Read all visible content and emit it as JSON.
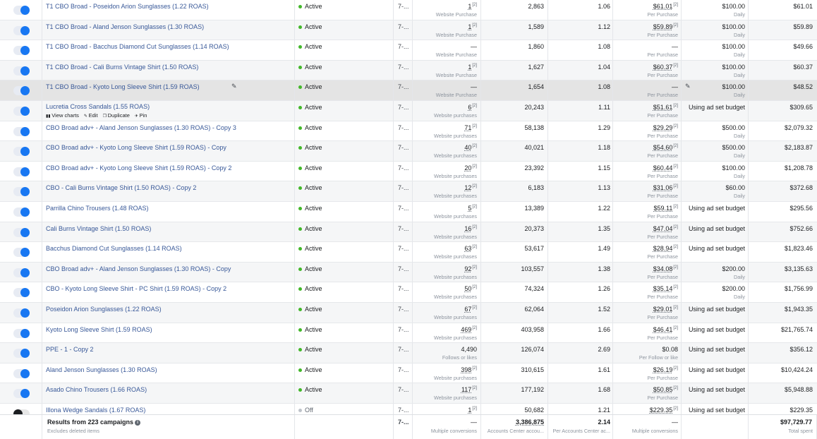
{
  "rows": [
    {
      "on": true,
      "name": "T1 CBO Broad - Poseidon Arion Sunglasses (1.22 ROAS)",
      "status": "Active",
      "attribution": "7-...",
      "results": "1",
      "results_sub": "Website Purchase",
      "reach": "2,863",
      "frequency": "1.06",
      "cost": "$61.01",
      "cost_sub": "Per Purchase",
      "budget": "$100.00",
      "budget_sub": "Daily",
      "spent": "$61.01"
    },
    {
      "on": true,
      "name": "T1 CBO Broad - Aland Jenson Sunglasses (1.30 ROAS)",
      "status": "Active",
      "attribution": "7-...",
      "results": "1",
      "results_sub": "Website Purchase",
      "reach": "1,589",
      "frequency": "1.12",
      "cost": "$59.89",
      "cost_sub": "Per Purchase",
      "budget": "$100.00",
      "budget_sub": "Daily",
      "spent": "$59.89"
    },
    {
      "on": true,
      "name": "T1 CBO Broad - Bacchus Diamond Cut Sunglasses (1.14 ROAS)",
      "status": "Active",
      "attribution": "7-...",
      "results": "—",
      "results_sub": "Website Purchase",
      "reach": "1,860",
      "frequency": "1.08",
      "cost": "—",
      "cost_sub": "Per Purchase",
      "budget": "$100.00",
      "budget_sub": "Daily",
      "spent": "$49.66"
    },
    {
      "on": true,
      "name": "T1 CBO Broad - Cali Burns Vintage Shirt (1.50 ROAS)",
      "status": "Active",
      "attribution": "7-...",
      "results": "1",
      "results_sub": "Website Purchase",
      "reach": "1,627",
      "frequency": "1.04",
      "cost": "$60.37",
      "cost_sub": "Per Purchase",
      "budget": "$100.00",
      "budget_sub": "Daily",
      "spent": "$60.37"
    },
    {
      "on": true,
      "name": "T1 CBO Broad - Kyoto Long Sleeve Shirt (1.59 ROAS)",
      "status": "Active",
      "attribution": "7-...",
      "results": "—",
      "results_sub": "Website Purchase",
      "reach": "1,654",
      "frequency": "1.08",
      "cost": "—",
      "cost_sub": "Per Purchase",
      "budget": "$100.00",
      "budget_sub": "Daily",
      "spent": "$48.52",
      "highlight": true
    },
    {
      "on": true,
      "name": "Lucretia Cross Sandals (1.55 ROAS)",
      "status": "Active",
      "attribution": "7-...",
      "results": "6",
      "results_sub": "Website purchases",
      "reach": "20,243",
      "frequency": "1.11",
      "cost": "$51.61",
      "cost_sub": "Per Purchase",
      "budget": "Using ad set budget",
      "budget_sub": "",
      "spent": "$309.65",
      "actions": {
        "view_charts": "View charts",
        "edit": "Edit",
        "duplicate": "Duplicate",
        "pin": "Pin"
      }
    },
    {
      "on": true,
      "name": "CBO Broad adv+ - Aland Jenson Sunglasses (1.30 ROAS) - Copy 3",
      "status": "Active",
      "attribution": "7-...",
      "results": "71",
      "results_sub": "Website purchases",
      "reach": "58,138",
      "frequency": "1.29",
      "cost": "$29.29",
      "cost_sub": "Per Purchase",
      "budget": "$500.00",
      "budget_sub": "Daily",
      "spent": "$2,079.32"
    },
    {
      "on": true,
      "name": "CBO Broad adv+ - Kyoto Long Sleeve Shirt (1.59 ROAS) - Copy",
      "status": "Active",
      "attribution": "7-...",
      "results": "40",
      "results_sub": "Website purchases",
      "reach": "40,021",
      "frequency": "1.18",
      "cost": "$54.60",
      "cost_sub": "Per Purchase",
      "budget": "$500.00",
      "budget_sub": "Daily",
      "spent": "$2,183.87"
    },
    {
      "on": true,
      "name": "CBO Broad adv+ - Kyoto Long Sleeve Shirt (1.59 ROAS) - Copy 2",
      "status": "Active",
      "attribution": "7-...",
      "results": "20",
      "results_sub": "Website purchases",
      "reach": "23,392",
      "frequency": "1.15",
      "cost": "$60.44",
      "cost_sub": "Per Purchase",
      "budget": "$100.00",
      "budget_sub": "Daily",
      "spent": "$1,208.78"
    },
    {
      "on": true,
      "name": "CBO - Cali Burns Vintage Shirt (1.50 ROAS) - Copy 2",
      "status": "Active",
      "attribution": "7-...",
      "results": "12",
      "results_sub": "Website purchases",
      "reach": "6,183",
      "frequency": "1.13",
      "cost": "$31.06",
      "cost_sub": "Per Purchase",
      "budget": "$60.00",
      "budget_sub": "Daily",
      "spent": "$372.68"
    },
    {
      "on": true,
      "name": "Parrilla Chino Trousers (1.48 ROAS)",
      "status": "Active",
      "attribution": "7-...",
      "results": "5",
      "results_sub": "Website purchases",
      "reach": "13,389",
      "frequency": "1.22",
      "cost": "$59.11",
      "cost_sub": "Per Purchase",
      "budget": "Using ad set budget",
      "budget_sub": "",
      "spent": "$295.56"
    },
    {
      "on": true,
      "name": "Cali Burns Vintage Shirt (1.50 ROAS)",
      "status": "Active",
      "attribution": "7-...",
      "results": "16",
      "results_sub": "Website purchases",
      "reach": "20,373",
      "frequency": "1.35",
      "cost": "$47.04",
      "cost_sub": "Per Purchase",
      "budget": "Using ad set budget",
      "budget_sub": "",
      "spent": "$752.66"
    },
    {
      "on": true,
      "name": "Bacchus Diamond Cut Sunglasses (1.14 ROAS)",
      "status": "Active",
      "attribution": "7-...",
      "results": "63",
      "results_sub": "Website purchases",
      "reach": "53,617",
      "frequency": "1.49",
      "cost": "$28.94",
      "cost_sub": "Per Purchase",
      "budget": "Using ad set budget",
      "budget_sub": "",
      "spent": "$1,823.46"
    },
    {
      "on": true,
      "name": "CBO Broad adv+ - Aland Jenson Sunglasses (1.30 ROAS) - Copy",
      "status": "Active",
      "attribution": "7-...",
      "results": "92",
      "results_sub": "Website purchases",
      "reach": "103,557",
      "frequency": "1.38",
      "cost": "$34.08",
      "cost_sub": "Per Purchase",
      "budget": "$200.00",
      "budget_sub": "Daily",
      "spent": "$3,135.63"
    },
    {
      "on": true,
      "name": "CBO - Kyoto Long Sleeve Shirt - PC Shirt (1.59 ROAS) - Copy 2",
      "status": "Active",
      "attribution": "7-...",
      "results": "50",
      "results_sub": "Website purchases",
      "reach": "74,324",
      "frequency": "1.26",
      "cost": "$35.14",
      "cost_sub": "Per Purchase",
      "budget": "$200.00",
      "budget_sub": "Daily",
      "spent": "$1,756.99"
    },
    {
      "on": true,
      "name": "Poseidon Arion Sunglasses (1.22 ROAS)",
      "status": "Active",
      "attribution": "7-...",
      "results": "67",
      "results_sub": "Website purchases",
      "reach": "62,064",
      "frequency": "1.52",
      "cost": "$29.01",
      "cost_sub": "Per Purchase",
      "budget": "Using ad set budget",
      "budget_sub": "",
      "spent": "$1,943.35"
    },
    {
      "on": true,
      "name": "Kyoto Long Sleeve Shirt (1.59 ROAS)",
      "status": "Active",
      "attribution": "7-...",
      "results": "469",
      "results_sub": "Website purchases",
      "reach": "403,958",
      "frequency": "1.66",
      "cost": "$46.41",
      "cost_sub": "Per Purchase",
      "budget": "Using ad set budget",
      "budget_sub": "",
      "spent": "$21,765.74"
    },
    {
      "on": true,
      "name": "PPE - 1 - Copy 2",
      "status": "Active",
      "attribution": "7-...",
      "results": "4,490",
      "results_sub": "Follows or likes",
      "reach": "126,074",
      "frequency": "2.69",
      "cost": "$0.08",
      "cost_sub": "Per Follow or like",
      "budget": "Using ad set budget",
      "budget_sub": "",
      "spent": "$356.12",
      "plain_results": true
    },
    {
      "on": true,
      "name": "Aland Jenson Sunglasses (1.30 ROAS)",
      "status": "Active",
      "attribution": "7-...",
      "results": "398",
      "results_sub": "Website purchases",
      "reach": "310,615",
      "frequency": "1.61",
      "cost": "$26.19",
      "cost_sub": "Per Purchase",
      "budget": "Using ad set budget",
      "budget_sub": "",
      "spent": "$10,424.24"
    },
    {
      "on": true,
      "name": "Asado Chino Trousers (1.66 ROAS)",
      "status": "Active",
      "attribution": "7-...",
      "results": "117",
      "results_sub": "Website purchases",
      "reach": "177,192",
      "frequency": "1.68",
      "cost": "$50.85",
      "cost_sub": "Per Purchase",
      "budget": "Using ad set budget",
      "budget_sub": "",
      "spent": "$5,948.88"
    },
    {
      "on": false,
      "name": "Illona Wedge Sandals (1.67 ROAS)",
      "status": "Off",
      "attribution": "7-...",
      "results": "1",
      "results_sub": "",
      "reach": "50,682",
      "frequency": "1.21",
      "cost": "$229.35",
      "cost_sub": "",
      "budget": "Using ad set budget",
      "budget_sub": "",
      "spent": "$229.35"
    }
  ],
  "footer": {
    "title": "Results from 223 campaigns",
    "subtitle": "Excludes deleted items",
    "attribution": "7-...",
    "results": "—",
    "results_sub": "Multiple conversions",
    "reach": "3,386,875",
    "reach_sub": "Accounts Center accou...",
    "frequency": "2.14",
    "frequency_sub": "Per Accounts Center ac...",
    "cost": "—",
    "cost_sub": "Multiple conversions",
    "spent": "$97,729.77",
    "spent_sub": "Total spent"
  },
  "colors": {
    "link": "#385898",
    "toggle_on": "#1877f2",
    "active_dot": "#42b72a"
  }
}
